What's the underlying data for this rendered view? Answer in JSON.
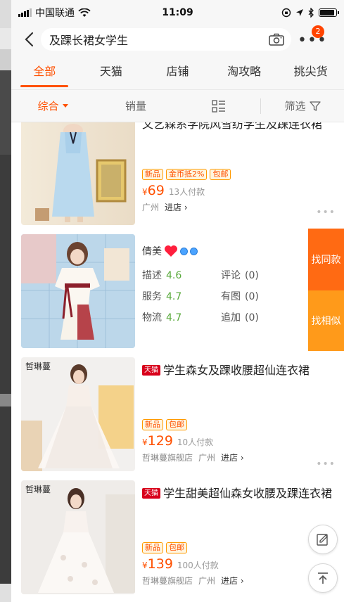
{
  "status": {
    "carrier": "中国联通",
    "time": "11:09",
    "battery_level": 0.9
  },
  "search": {
    "query": "及踝长裙女学生",
    "badge_count": "2"
  },
  "tabs": [
    {
      "label": "全部",
      "active": true
    },
    {
      "label": "天猫",
      "active": false
    },
    {
      "label": "店铺",
      "active": false
    },
    {
      "label": "淘攻略",
      "active": false
    },
    {
      "label": "挑尖货",
      "active": false
    }
  ],
  "sort": {
    "comprehensive": "综合",
    "sales": "销量",
    "filter": "筛选"
  },
  "items": [
    {
      "title": "文艺森系学院风雪纺学生及踝连衣裙",
      "tags": [
        "新品",
        "金币抵2%",
        "包邮"
      ],
      "currency": "¥",
      "price": "69",
      "sales": "13人付款",
      "location": "广州",
      "enter": "进店"
    },
    {
      "shop_name": "倩美",
      "ratings": [
        {
          "label": "描述",
          "value": "4.6"
        },
        {
          "label": "评论",
          "value": "(0)"
        },
        {
          "label": "服务",
          "value": "4.7"
        },
        {
          "label": "有图",
          "value": "(0)"
        },
        {
          "label": "物流",
          "value": "4.7"
        },
        {
          "label": "追加",
          "value": "(0)"
        }
      ],
      "find_same": "找同款",
      "find_similar": "找相似"
    },
    {
      "tmall_tag": "天猫",
      "title": "学生森女及踝收腰超仙连衣裙",
      "tags": [
        "新品",
        "包邮"
      ],
      "currency": "¥",
      "price": "129",
      "sales": "10人付款",
      "shop": "哲琳蔓旗舰店",
      "location": "广州",
      "enter": "进店",
      "brand_mark": "哲琳蔓"
    },
    {
      "tmall_tag": "天猫",
      "title": "学生甜美超仙森女收腰及踝连衣裙",
      "tags": [
        "新品",
        "包邮"
      ],
      "currency": "¥",
      "price": "139",
      "sales": "100人付款",
      "shop": "哲琳蔓旗舰店",
      "location": "广州",
      "enter": "进店",
      "brand_mark": "哲琳蔓"
    }
  ],
  "colors": {
    "accent": "#ff5000",
    "find_same": "#ff6a13",
    "find_similar": "#ff9a1a",
    "tmall": "#d8001b",
    "rating_green": "#5aaa3c"
  }
}
